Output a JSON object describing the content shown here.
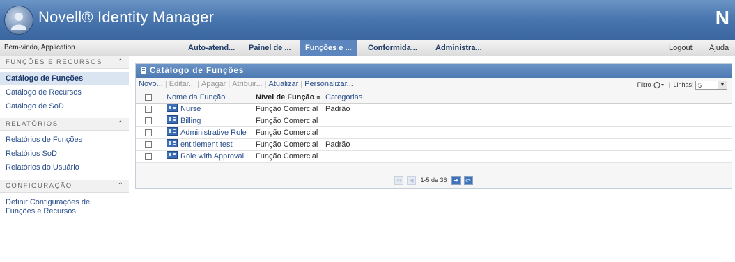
{
  "header": {
    "brand": "Novell® Identity Manager",
    "corner_logo": "N"
  },
  "nav": {
    "welcome": "Bem-vindo, Application",
    "tabs": [
      {
        "label": "Auto-atend..."
      },
      {
        "label": "Painel de ..."
      },
      {
        "label": "Funções e ...",
        "active": true
      },
      {
        "label": "Conformida..."
      },
      {
        "label": "Administra..."
      }
    ],
    "logout": "Logout",
    "help": "Ajuda"
  },
  "sidebar": {
    "sections": [
      {
        "title": "FUNÇÕES E RECURSOS",
        "items": [
          "Catálogo de Funções",
          "Catálogo de Recursos",
          "Catálogo de SoD"
        ]
      },
      {
        "title": "RELATÓRIOS",
        "items": [
          "Relatórios de Funções",
          "Relatórios SoD",
          "Relatórios do Usuário"
        ]
      },
      {
        "title": "CONFIGURAÇÃO",
        "items": [
          "Definir Configurações de Funções e Recursos"
        ]
      }
    ]
  },
  "panel": {
    "title": "Catálogo de Funções",
    "toolbar": {
      "new": "Novo...",
      "edit": "Editar...",
      "delete": "Apagar",
      "assign": "Atribuir...",
      "refresh": "Atualizar",
      "customize": "Personalizar...",
      "filter": "Filtro",
      "lines_label": "Linhas:",
      "lines_value": "5"
    },
    "columns": [
      "Nome da Função",
      "Nível de Função",
      "Categorias"
    ],
    "rows": [
      {
        "name": "Nurse",
        "level": "Função Comercial",
        "category": "Padrão"
      },
      {
        "name": "Billing",
        "level": "Função Comercial",
        "category": ""
      },
      {
        "name": "Administrative Role",
        "level": "Função Comercial",
        "category": ""
      },
      {
        "name": "entitlement test",
        "level": "Função Comercial",
        "category": "Padrão"
      },
      {
        "name": "Role with Approval",
        "level": "Função Comercial",
        "category": ""
      }
    ],
    "pager": "1-5 de 36"
  },
  "colors": {
    "header_blue": "#4a77b0",
    "active_tab": "#5d86bf",
    "link": "#2a4f8c"
  }
}
